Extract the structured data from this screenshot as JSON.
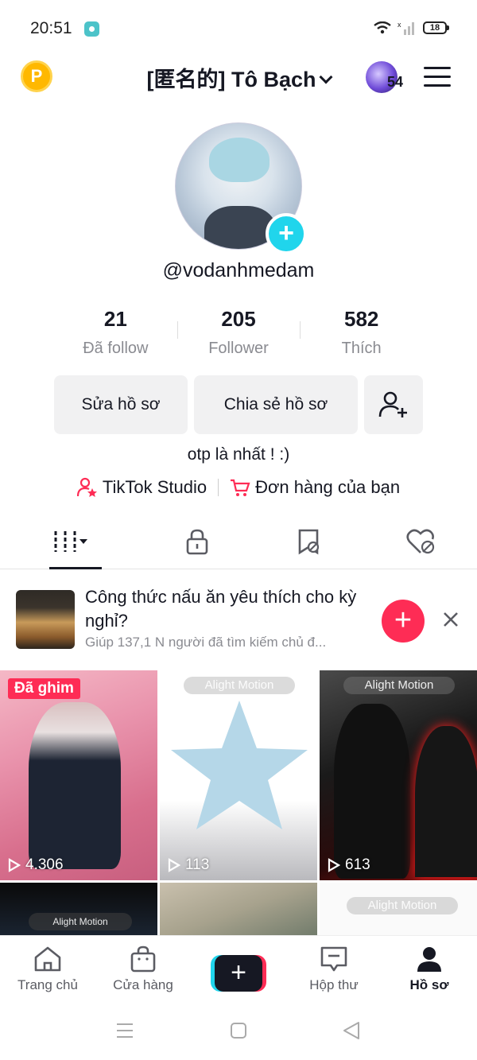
{
  "status_bar": {
    "time": "20:51",
    "battery": "18",
    "icons": [
      "wifi-icon",
      "signal-icon",
      "battery-icon"
    ]
  },
  "header": {
    "coin_icon": "P",
    "title": "[匿名的] Tô Bạch",
    "story_count": "54"
  },
  "profile": {
    "username": "@vodanhmedam",
    "stats": [
      {
        "value": "21",
        "label": "Đã follow"
      },
      {
        "value": "205",
        "label": "Follower"
      },
      {
        "value": "582",
        "label": "Thích"
      }
    ],
    "edit_button": "Sửa hồ sơ",
    "share_button": "Chia sẻ hồ sơ",
    "bio": "otp là nhất ! :)",
    "studio_link": "TikTok Studio",
    "orders_link": "Đơn hàng của bạn"
  },
  "suggestion": {
    "title": "Công thức nấu ăn yêu thích cho kỳ nghỉ?",
    "subtitle": "Giúp 137,1 N người đã tìm kiếm chủ đ..."
  },
  "videos": [
    {
      "badge": "Đã ghim",
      "watermark": "",
      "views": "4.306"
    },
    {
      "badge": "",
      "watermark": "Alight Motion",
      "views": "113"
    },
    {
      "badge": "",
      "watermark": "Alight Motion",
      "views": "613"
    },
    {
      "badge": "",
      "watermark": "Alight Motion",
      "views": ""
    },
    {
      "badge": "",
      "watermark": "",
      "views": ""
    },
    {
      "badge": "",
      "watermark": "Alight Motion",
      "views": ""
    }
  ],
  "bottom_nav": [
    {
      "label": "Trang chủ",
      "icon": "home-icon"
    },
    {
      "label": "Cửa hàng",
      "icon": "shop-icon"
    },
    {
      "label": "",
      "icon": "create-icon"
    },
    {
      "label": "Hộp thư",
      "icon": "inbox-icon"
    },
    {
      "label": "Hồ sơ",
      "icon": "profile-icon"
    }
  ],
  "colors": {
    "accent": "#fe2c55",
    "teal": "#20d5ec",
    "text": "#161823",
    "muted": "#8a8b91"
  }
}
